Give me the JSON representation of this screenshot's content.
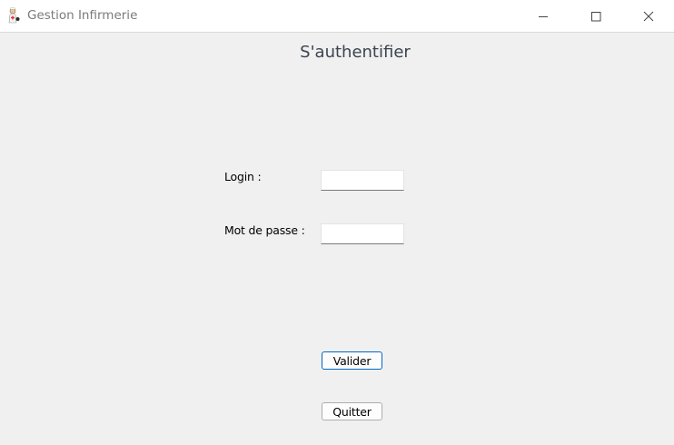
{
  "window": {
    "title": "Gestion Infirmerie",
    "icon": "nurse-app-icon",
    "controls": {
      "minimize": "minimize-icon",
      "maximize": "maximize-icon",
      "close": "close-icon"
    }
  },
  "form": {
    "heading": "S'authentifier",
    "login_label": "Login :",
    "login_value": "",
    "password_label": "Mot de passe :",
    "password_value": "",
    "submit_label": "Valider",
    "quit_label": "Quitter"
  },
  "colors": {
    "background": "#f0f0f0",
    "titlebar": "#ffffff",
    "accent": "#0067c0",
    "heading": "#3b4450"
  }
}
